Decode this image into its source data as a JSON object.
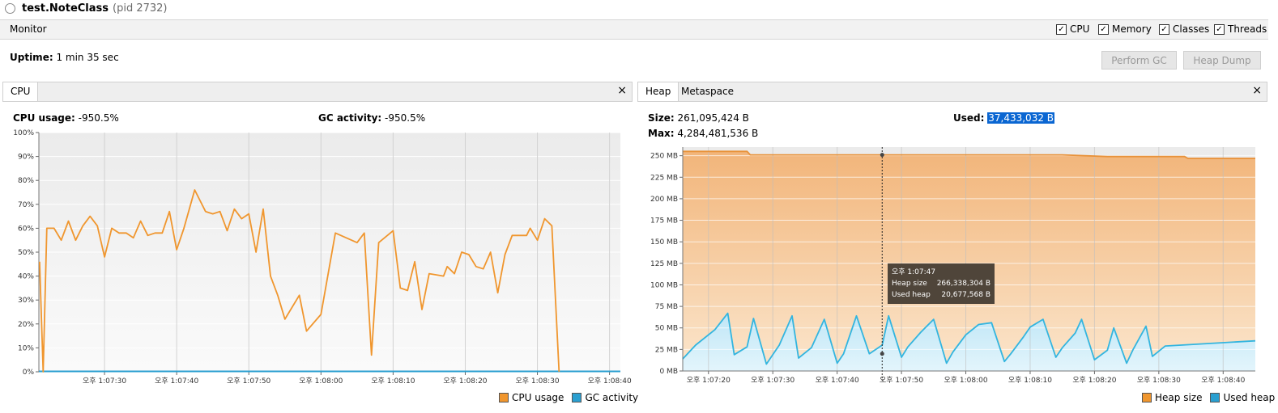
{
  "window": {
    "app_name": "test.NoteClass",
    "pid": "(pid 2732)"
  },
  "monitor": {
    "title": "Monitor",
    "checkboxes": [
      {
        "label": "CPU",
        "checked": true
      },
      {
        "label": "Memory",
        "checked": true
      },
      {
        "label": "Classes",
        "checked": true
      },
      {
        "label": "Threads",
        "checked": true
      }
    ]
  },
  "uptime": {
    "label": "Uptime:",
    "value": "1 min 35 sec"
  },
  "buttons": {
    "perform_gc": "Perform GC",
    "heap_dump": "Heap Dump"
  },
  "cpu_panel": {
    "tab": "CPU",
    "close": "×",
    "cpu_usage_label": "CPU usage:",
    "cpu_usage_value": "-950.5%",
    "gc_activity_label": "GC activity:",
    "gc_activity_value": "-950.5%",
    "legend": [
      "CPU usage",
      "GC activity"
    ]
  },
  "heap_panel": {
    "tabs": [
      "Heap",
      "Metaspace"
    ],
    "close": "×",
    "size_label": "Size:",
    "size_value": "261,095,424 B",
    "used_label": "Used:",
    "used_value": "37,433,032 B",
    "max_label": "Max:",
    "max_value": "4,284,481,536 B",
    "legend": [
      "Heap size",
      "Used heap"
    ],
    "tooltip": {
      "time": "오후 1:07:47",
      "heap_size_label": "Heap size",
      "heap_size_value": "266,338,304  B",
      "used_heap_label": "Used heap",
      "used_heap_value": "20,677,568  B"
    }
  },
  "colors": {
    "cpu": "#f0962e",
    "gc": "#2a9fd0",
    "heap_fill": "#f4c08a",
    "used": "#33b5df",
    "selection": "#0a66d2"
  },
  "chart_data": [
    {
      "type": "line",
      "title": "CPU",
      "x_unit": "time",
      "x": [
        "1:07:21.0",
        "1:07:21.5",
        "1:07:22.0",
        "1:07:23.0",
        "1:07:24.0",
        "1:07:25.0",
        "1:07:26.0",
        "1:07:27.0",
        "1:07:28.0",
        "1:07:29.0",
        "1:07:30.0",
        "1:07:31.0",
        "1:07:32.0",
        "1:07:33.0",
        "1:07:34.0",
        "1:07:35.0",
        "1:07:36.0",
        "1:07:37.0",
        "1:07:38.0",
        "1:07:39.0",
        "1:07:40.0",
        "1:07:41.0",
        "1:07:42.5",
        "1:07:44.0",
        "1:07:45.0",
        "1:07:46.0",
        "1:07:47.0",
        "1:07:48.0",
        "1:07:49.0",
        "1:07:50.0",
        "1:07:51.0",
        "1:07:52.0",
        "1:07:53.0",
        "1:07:54.0",
        "1:07:55.0",
        "1:07:57.0",
        "1:07:58.0",
        "1:08:00.0",
        "1:08:02.0",
        "1:08:05.0",
        "1:08:06.0",
        "1:08:07.0",
        "1:08:08.0",
        "1:08:10.0",
        "1:08:11.0",
        "1:08:12.0",
        "1:08:13.0",
        "1:08:14.0",
        "1:08:15.0",
        "1:08:17.0",
        "1:08:17.5",
        "1:08:18.5",
        "1:08:19.5",
        "1:08:20.5",
        "1:08:21.5",
        "1:08:22.5",
        "1:08:23.5",
        "1:08:24.5",
        "1:08:25.5",
        "1:08:26.5",
        "1:08:28.5",
        "1:08:29.0",
        "1:08:30.0",
        "1:08:31.0",
        "1:08:32.0",
        "1:08:33.0",
        "1:08:34.0",
        "1:08:41.5"
      ],
      "series": [
        {
          "name": "CPU usage",
          "values": [
            46,
            0,
            60,
            60,
            55,
            63,
            55,
            61,
            65,
            61,
            48,
            60,
            58,
            58,
            56,
            63,
            57,
            58,
            58,
            67,
            51,
            60,
            76,
            67,
            66,
            67,
            59,
            68,
            64,
            66,
            50,
            68,
            40,
            32,
            22,
            32,
            17,
            24,
            58,
            54,
            58,
            7,
            54,
            59,
            35,
            34,
            46,
            26,
            41,
            40,
            44,
            41,
            50,
            49,
            44,
            43,
            50,
            33,
            49,
            57,
            57,
            60,
            55,
            64,
            61,
            0
          ]
        },
        {
          "name": "GC activity",
          "values": [
            0,
            0
          ]
        }
      ],
      "x_ticks": [
        "오후 1:07:30",
        "오후 1:07:40",
        "오후 1:07:50",
        "오후 1:08:00",
        "오후 1:08:10",
        "오후 1:08:20",
        "오후 1:08:30",
        "오후 1:08:40"
      ],
      "y_ticks": [
        "0%",
        "10%",
        "20%",
        "30%",
        "40%",
        "50%",
        "60%",
        "70%",
        "80%",
        "90%",
        "100%"
      ],
      "ylim": [
        0,
        100
      ],
      "grid": true,
      "legend": "bottom-right"
    },
    {
      "type": "area",
      "title": "Heap",
      "x_unit": "time",
      "series": [
        {
          "name": "Heap size",
          "x": [
            "1:07:16",
            "1:07:26",
            "1:07:26.5",
            "1:07:40",
            "1:07:55",
            "1:08:05",
            "1:08:15",
            "1:08:22",
            "1:08:29",
            "1:08:34",
            "1:08:34.5",
            "1:08:45"
          ],
          "values_mb": [
            255,
            255,
            251,
            251,
            251,
            251,
            251,
            249,
            249,
            249,
            247,
            247
          ]
        },
        {
          "name": "Used heap",
          "x": [
            "1:07:16",
            "1:07:18",
            "1:07:21",
            "1:07:23",
            "1:07:24",
            "1:07:26",
            "1:07:27",
            "1:07:29",
            "1:07:31",
            "1:07:33",
            "1:07:34",
            "1:07:36",
            "1:07:38",
            "1:07:40",
            "1:07:41",
            "1:07:43",
            "1:07:45",
            "1:07:47",
            "1:07:48",
            "1:07:50",
            "1:07:51",
            "1:07:53",
            "1:07:55",
            "1:07:57",
            "1:07:58",
            "1:08:00",
            "1:08:02",
            "1:08:04",
            "1:08:06",
            "1:08:07",
            "1:08:09",
            "1:08:10",
            "1:08:12",
            "1:08:14",
            "1:08:15",
            "1:08:17",
            "1:08:18",
            "1:08:20",
            "1:08:22",
            "1:08:23",
            "1:08:25",
            "1:08:26",
            "1:08:28",
            "1:08:29",
            "1:08:31",
            "1:08:45"
          ],
          "values_mb": [
            14,
            30,
            48,
            67,
            19,
            28,
            61,
            8,
            30,
            64,
            15,
            27,
            60,
            9,
            20,
            64,
            20,
            30,
            64,
            16,
            28,
            45,
            60,
            9,
            22,
            42,
            54,
            56,
            11,
            20,
            40,
            51,
            60,
            16,
            27,
            44,
            60,
            13,
            24,
            50,
            9,
            25,
            52,
            17,
            29,
            35
          ]
        }
      ],
      "x_ticks": [
        "오후 1:07:20",
        "오후 1:07:30",
        "오후 1:07:40",
        "오후 1:07:50",
        "오후 1:08:00",
        "오후 1:08:10",
        "오후 1:08:20",
        "오후 1:08:30",
        "오후 1:08:40"
      ],
      "y_ticks": [
        "0 MB",
        "25 MB",
        "50 MB",
        "75 MB",
        "100 MB",
        "125 MB",
        "150 MB",
        "175 MB",
        "200 MB",
        "225 MB",
        "250 MB"
      ],
      "ylim": [
        0,
        260
      ],
      "grid": true,
      "legend": "bottom-right"
    }
  ]
}
